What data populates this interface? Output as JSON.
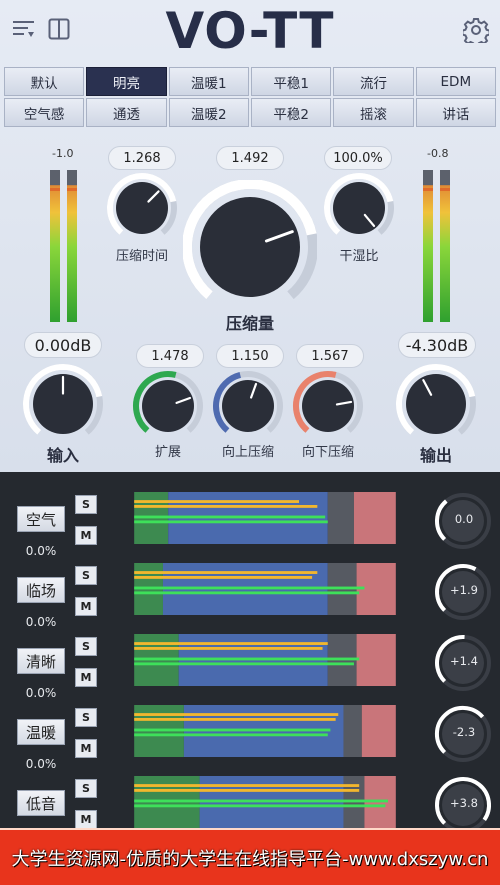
{
  "header": {
    "title": "VO-TT",
    "menu_icon": "list-menu-icon",
    "layout_icon": "split-panel-icon",
    "settings_icon": "gear-icon"
  },
  "presets": {
    "active": "明亮",
    "items": [
      "默认",
      "明亮",
      "温暖1",
      "平稳1",
      "流行",
      "EDM",
      "空气感",
      "通透",
      "温暖2",
      "平稳2",
      "摇滚",
      "讲话"
    ]
  },
  "meters": {
    "input_peak": "-1.0",
    "output_peak": "-0.8",
    "input_level": 0.9,
    "output_level": 0.9
  },
  "knobs": {
    "comp_time": {
      "value": "1.268",
      "label": "压缩时间"
    },
    "compression": {
      "value": "1.492",
      "label": "压缩量"
    },
    "dry_wet": {
      "value": "100.0%",
      "label": "干湿比"
    },
    "input": {
      "value": "0.00dB",
      "label": "输入"
    },
    "expand": {
      "value": "1.478",
      "label": "扩展"
    },
    "upward": {
      "value": "1.150",
      "label": "向上压缩"
    },
    "downward": {
      "value": "1.567",
      "label": "向下压缩"
    },
    "output": {
      "value": "-4.30dB",
      "label": "输出"
    }
  },
  "bands": [
    {
      "name": "空气",
      "pct": "0.0%",
      "gain": "0.0"
    },
    {
      "name": "临场",
      "pct": "0.0%",
      "gain": "+1.9"
    },
    {
      "name": "清晰",
      "pct": "0.0%",
      "gain": "+1.4"
    },
    {
      "name": "温暖",
      "pct": "0.0%",
      "gain": "-2.3"
    },
    {
      "name": "低音",
      "pct": "",
      "gain": "+3.8"
    }
  ],
  "solo_label": "S",
  "mute_label": "M",
  "colors": {
    "accent_green": "#2ea84f",
    "accent_blue": "#4f6bb0",
    "accent_red": "#e9826c",
    "banner": "#e8341c"
  },
  "banner": "大学生资源网-优质的大学生在线指导平台-www.dxszyw.cn"
}
